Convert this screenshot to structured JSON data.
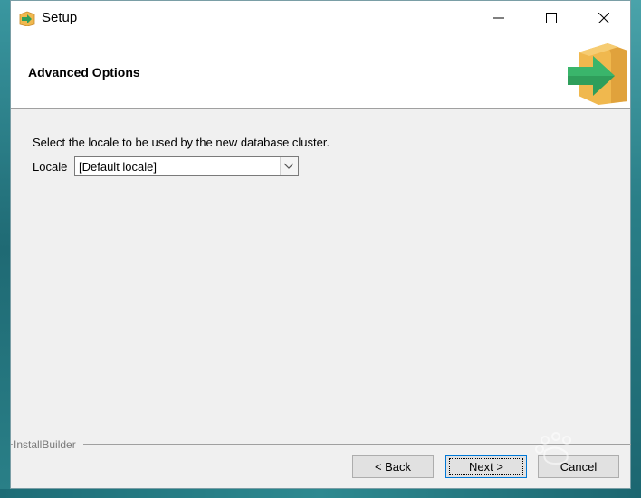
{
  "window": {
    "title": "Setup",
    "controls": {
      "minimize": "minimize",
      "maximize": "maximize",
      "close": "close"
    }
  },
  "header": {
    "title": "Advanced Options",
    "logo_icon": "green-arrow-box-icon"
  },
  "content": {
    "description": "Select the locale to be used by the new database cluster.",
    "locale_label": "Locale",
    "locale_value": "[Default locale]"
  },
  "footer": {
    "brand": "InstallBuilder",
    "back_label": "< Back",
    "next_label": "Next >",
    "cancel_label": "Cancel"
  },
  "colors": {
    "accent": "#0078d7",
    "logo_box": "#f0b84e",
    "logo_arrow": "#2f9e5b"
  }
}
